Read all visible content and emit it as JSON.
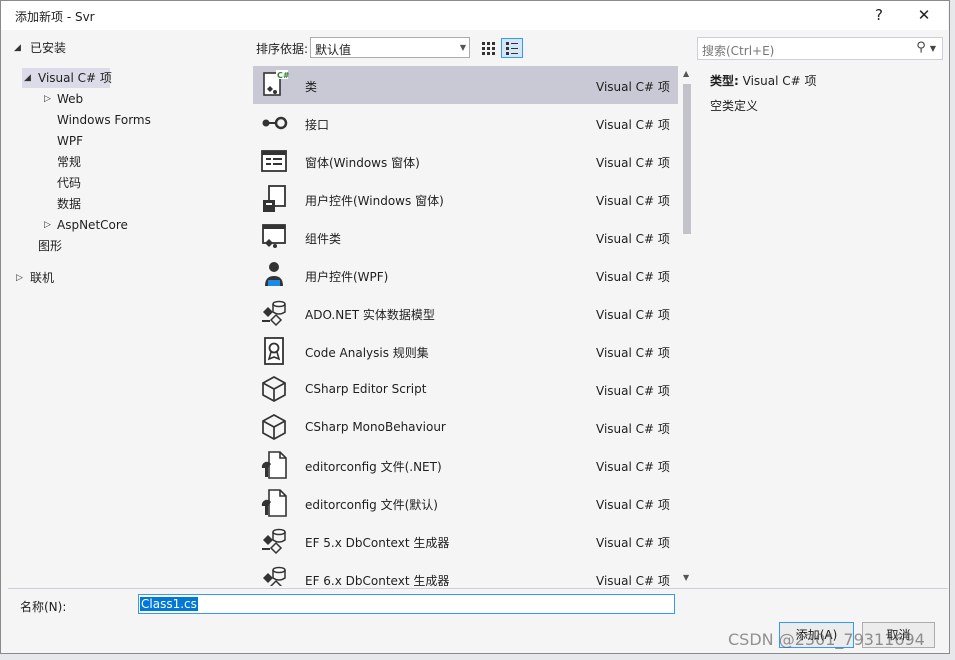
{
  "window": {
    "title": "添加新项 - Svr",
    "help": "?",
    "close": "✕"
  },
  "toolbar": {
    "sort_label": "排序依据:",
    "sort_value": "默认值",
    "search_placeholder": "搜索(Ctrl+E)"
  },
  "tree": {
    "installed": "已安装",
    "visual_csharp": "Visual C# 项",
    "web": "Web",
    "winforms": "Windows Forms",
    "wpf": "WPF",
    "general": "常规",
    "code": "代码",
    "data": "数据",
    "aspnetcore": "AspNetCore",
    "graphics": "图形",
    "online": "联机"
  },
  "items": [
    {
      "name": "类",
      "type": "Visual C# 项",
      "icon": "class-icon"
    },
    {
      "name": "接口",
      "type": "Visual C# 项",
      "icon": "interface-icon"
    },
    {
      "name": "窗体(Windows 窗体)",
      "type": "Visual C# 项",
      "icon": "form-icon"
    },
    {
      "name": "用户控件(Windows 窗体)",
      "type": "Visual C# 项",
      "icon": "user-control-icon"
    },
    {
      "name": "组件类",
      "type": "Visual C# 项",
      "icon": "component-icon"
    },
    {
      "name": "用户控件(WPF)",
      "type": "Visual C# 项",
      "icon": "wpf-user-control-icon"
    },
    {
      "name": "ADO.NET 实体数据模型",
      "type": "Visual C# 项",
      "icon": "entity-model-icon"
    },
    {
      "name": "Code Analysis 规则集",
      "type": "Visual C# 项",
      "icon": "ruleset-icon"
    },
    {
      "name": "CSharp Editor Script",
      "type": "Visual C# 项",
      "icon": "cube-icon"
    },
    {
      "name": "CSharp MonoBehaviour",
      "type": "Visual C# 项",
      "icon": "cube-icon"
    },
    {
      "name": "editorconfig 文件(.NET)",
      "type": "Visual C# 项",
      "icon": "config-file-icon"
    },
    {
      "name": "editorconfig 文件(默认)",
      "type": "Visual C# 项",
      "icon": "config-file-icon"
    },
    {
      "name": "EF 5.x DbContext 生成器",
      "type": "Visual C# 项",
      "icon": "entity-model-icon"
    },
    {
      "name": "EF 6.x DbContext 生成器",
      "type": "Visual C# 项",
      "icon": "entity-model-icon"
    }
  ],
  "detail": {
    "type_label": "类型:",
    "type_value": "Visual C# 项",
    "description": "空类定义"
  },
  "name_field": {
    "label": "名称(N):",
    "value": "Class1.cs"
  },
  "buttons": {
    "add": "添加(A)",
    "cancel": "取消"
  },
  "watermark": "CSDN @2301_79311694",
  "colors": {
    "accent": "#3399ff",
    "selection": "#c9c9d6",
    "text_selection": "#0078d7"
  }
}
